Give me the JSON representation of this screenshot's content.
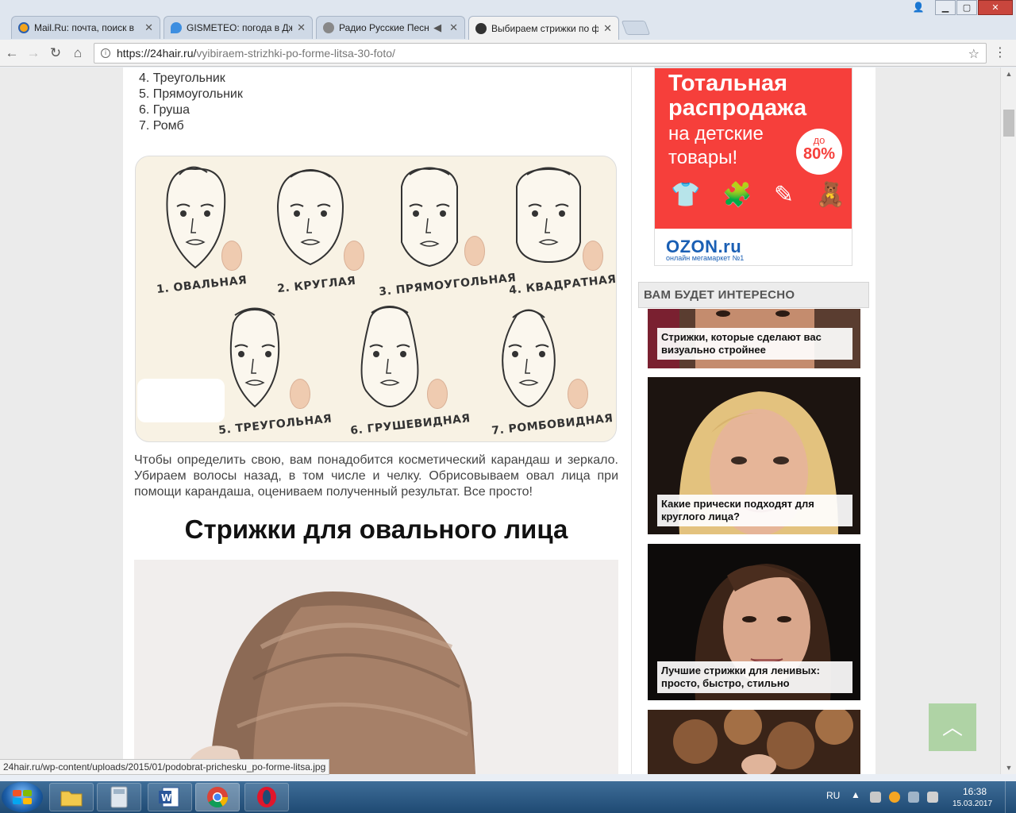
{
  "browser": {
    "tabs": [
      {
        "title": "Mail.Ru: почта, поиск в",
        "favicon_color": "#f3a41c"
      },
      {
        "title": "GISMETEO: погода в Дж",
        "favicon_color": "#3d8ee0"
      },
      {
        "title": "Радио Русские Песни",
        "favicon_color": "#888888"
      },
      {
        "title": "Выбираем стрижки по ф",
        "favicon_color": "#333333"
      }
    ],
    "url_host": "https://24hair.ru/",
    "url_path": "vyibiraem-strizhki-po-forme-litsa-30-foto/",
    "status_url": "24hair.ru/wp-content/uploads/2015/01/podobrat-prichesku_po-forme-litsa.jpg"
  },
  "article": {
    "list_items": [
      "4. Треугольник",
      "5. Прямоугольник",
      "6. Груша",
      "7. Ромб"
    ],
    "face_labels": [
      "1. ОВАЛЬНАЯ",
      "2. КРУГЛАЯ",
      "3. ПРЯМОУГОЛЬНАЯ",
      "4. КВАДРАТНАЯ",
      "5. ТРЕУГОЛЬНАЯ",
      "6. ГРУШЕВИДНАЯ",
      "7. РОМБОВИДНАЯ"
    ],
    "paragraph": "Чтобы определить свою, вам понадобится косметический карандаш и зеркало. Убираем волосы назад, в том числе и челку. Обрисовываем овал лица при помощи карандаша, оцениваем полученный результат. Все просто!",
    "heading": "Стрижки для овального лица"
  },
  "sidebar": {
    "ad": {
      "line1": "Тотальная распродажа",
      "line2": "на детские товары!",
      "badge_small": "до",
      "badge_big": "80%",
      "logo": "OZON.ru",
      "tagline": "онлайн мегамаркет №1",
      "accent": "#f63f3b"
    },
    "block_title": "ВАМ БУДЕТ ИНТЕРЕСНО",
    "cards": [
      {
        "caption": "Стрижки, которые сделают вас визуально стройнее"
      },
      {
        "caption": "Какие прически подходят для круглого лица?"
      },
      {
        "caption": "Лучшие стрижки для ленивых: просто, быстро, стильно"
      }
    ]
  },
  "taskbar": {
    "lang": "RU",
    "time": "16:38",
    "date": "15.03.2017"
  }
}
